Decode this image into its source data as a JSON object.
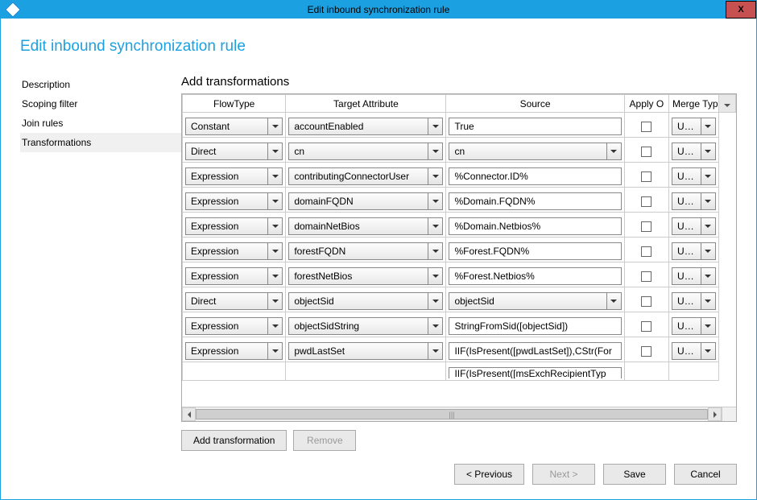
{
  "window": {
    "title": "Edit inbound synchronization rule"
  },
  "page": {
    "title": "Edit inbound synchronization rule"
  },
  "sidebar": {
    "items": [
      {
        "label": "Description"
      },
      {
        "label": "Scoping filter"
      },
      {
        "label": "Join rules"
      },
      {
        "label": "Transformations"
      }
    ],
    "activeIndex": 3
  },
  "section": {
    "title": "Add transformations"
  },
  "table": {
    "headers": {
      "flowType": "FlowType",
      "target": "Target Attribute",
      "source": "Source",
      "applyOnce": "Apply O",
      "mergeType": "Merge Type"
    },
    "rows": [
      {
        "flowType": "Constant",
        "target": "accountEnabled",
        "source": "True",
        "sourceKind": "text",
        "applyOnce": false,
        "mergeType": "Update"
      },
      {
        "flowType": "Direct",
        "target": "cn",
        "source": "cn",
        "sourceKind": "combo",
        "applyOnce": false,
        "mergeType": "Update"
      },
      {
        "flowType": "Expression",
        "target": "contributingConnectorUser",
        "source": "%Connector.ID%",
        "sourceKind": "text",
        "applyOnce": false,
        "mergeType": "Update"
      },
      {
        "flowType": "Expression",
        "target": "domainFQDN",
        "source": "%Domain.FQDN%",
        "sourceKind": "text",
        "applyOnce": false,
        "mergeType": "Update"
      },
      {
        "flowType": "Expression",
        "target": "domainNetBios",
        "source": "%Domain.Netbios%",
        "sourceKind": "text",
        "applyOnce": false,
        "mergeType": "Update"
      },
      {
        "flowType": "Expression",
        "target": "forestFQDN",
        "source": "%Forest.FQDN%",
        "sourceKind": "text",
        "applyOnce": false,
        "mergeType": "Update"
      },
      {
        "flowType": "Expression",
        "target": "forestNetBios",
        "source": "%Forest.Netbios%",
        "sourceKind": "text",
        "applyOnce": false,
        "mergeType": "Update"
      },
      {
        "flowType": "Direct",
        "target": "objectSid",
        "source": "objectSid",
        "sourceKind": "combo",
        "applyOnce": false,
        "mergeType": "Update"
      },
      {
        "flowType": "Expression",
        "target": "objectSidString",
        "source": "StringFromSid([objectSid])",
        "sourceKind": "text",
        "applyOnce": false,
        "mergeType": "Update"
      },
      {
        "flowType": "Expression",
        "target": "pwdLastSet",
        "source": "IIF(IsPresent([pwdLastSet]),CStr(For",
        "sourceKind": "text",
        "applyOnce": false,
        "mergeType": "Update"
      }
    ],
    "cutoffSource": "IIF(IsPresent([msExchRecipientTyp"
  },
  "buttons": {
    "addTransformation": "Add transformation",
    "remove": "Remove",
    "previous": "< Previous",
    "next": "Next >",
    "save": "Save",
    "cancel": "Cancel"
  }
}
